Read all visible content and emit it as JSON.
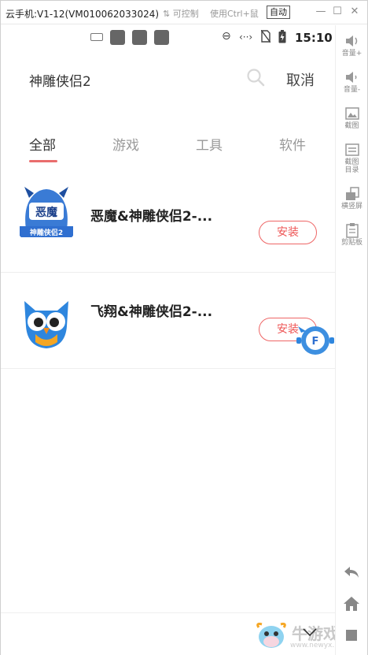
{
  "window": {
    "title": "云手机:V1-12(VM010062033024)",
    "ctrl_label": "可控制",
    "hint": "使用Ctrl+鼠",
    "auto_label": "自动"
  },
  "status_bar": {
    "time": "15:10"
  },
  "search": {
    "query": "神雕侠侣2",
    "cancel_label": "取消"
  },
  "tabs": [
    {
      "label": "全部",
      "active": true
    },
    {
      "label": "游戏",
      "active": false
    },
    {
      "label": "工具",
      "active": false
    },
    {
      "label": "软件",
      "active": false
    }
  ],
  "results": [
    {
      "name": "恶魔&神雕侠侣2-...",
      "button": "安装",
      "icon_text": "恶魔",
      "icon_sub": "神雕侠侣2"
    },
    {
      "name": "飞翔&神雕侠侣2-...",
      "button": "安装"
    }
  ],
  "side_panel": [
    {
      "label": "音量+",
      "icon": "volume-up-icon"
    },
    {
      "label": "音量-",
      "icon": "volume-down-icon"
    },
    {
      "label": "截图",
      "icon": "screenshot-icon"
    },
    {
      "label": "截图目录",
      "icon": "screenshot-folder-icon"
    },
    {
      "label": "横竖屏",
      "icon": "rotate-icon"
    },
    {
      "label": "剪贴板",
      "icon": "clipboard-icon"
    }
  ],
  "watermark": {
    "text": "牛游戏网",
    "url": "www.newyx.net"
  },
  "colors": {
    "accent": "#e96d6d",
    "install_border": "#ee6666"
  }
}
